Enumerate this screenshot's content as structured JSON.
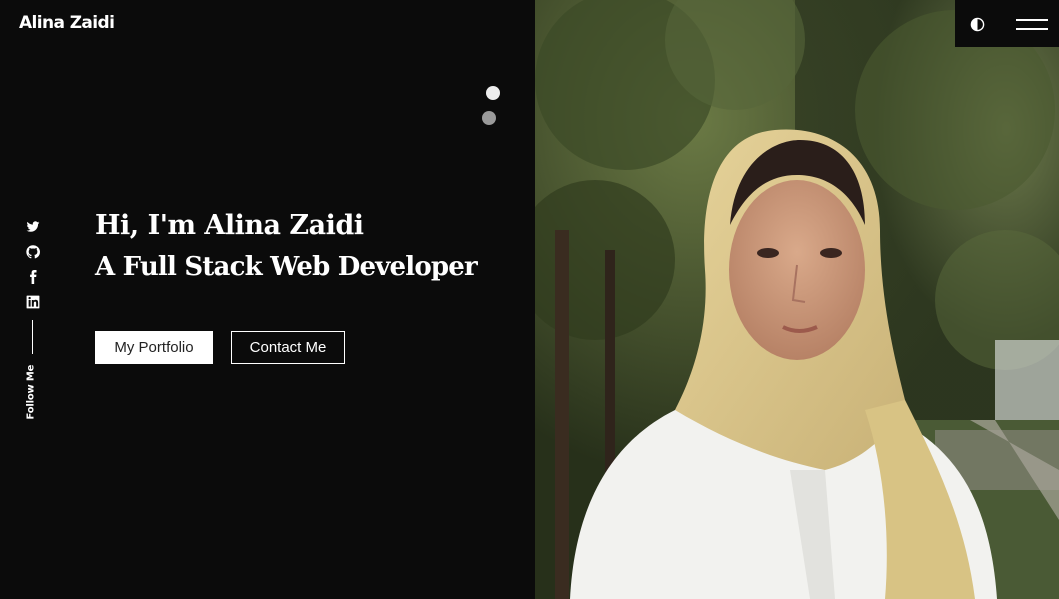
{
  "brand": {
    "name": "Alina Zaidi"
  },
  "hero": {
    "greeting": "Hi, I'm Alina Zaidi",
    "headline": "A Full Stack Web Developer",
    "buttons": {
      "portfolio": "My Portfolio",
      "contact": "Contact Me"
    }
  },
  "social": {
    "items": [
      {
        "icon": "twitter-icon"
      },
      {
        "icon": "github-icon"
      },
      {
        "icon": "facebook-icon"
      },
      {
        "icon": "linkedin-icon"
      }
    ],
    "follow_label": "Follow Me"
  },
  "slider": {
    "slides": 2,
    "active_index": 0
  },
  "header": {
    "theme_toggle_icon": "contrast-icon",
    "menu_icon": "hamburger-menu-icon"
  },
  "photo": {
    "subject": "portrait-photo"
  },
  "colors": {
    "background": "#0b0b0b",
    "text": "#ffffff",
    "button_fill": "#ffffff",
    "button_text": "#222222"
  }
}
